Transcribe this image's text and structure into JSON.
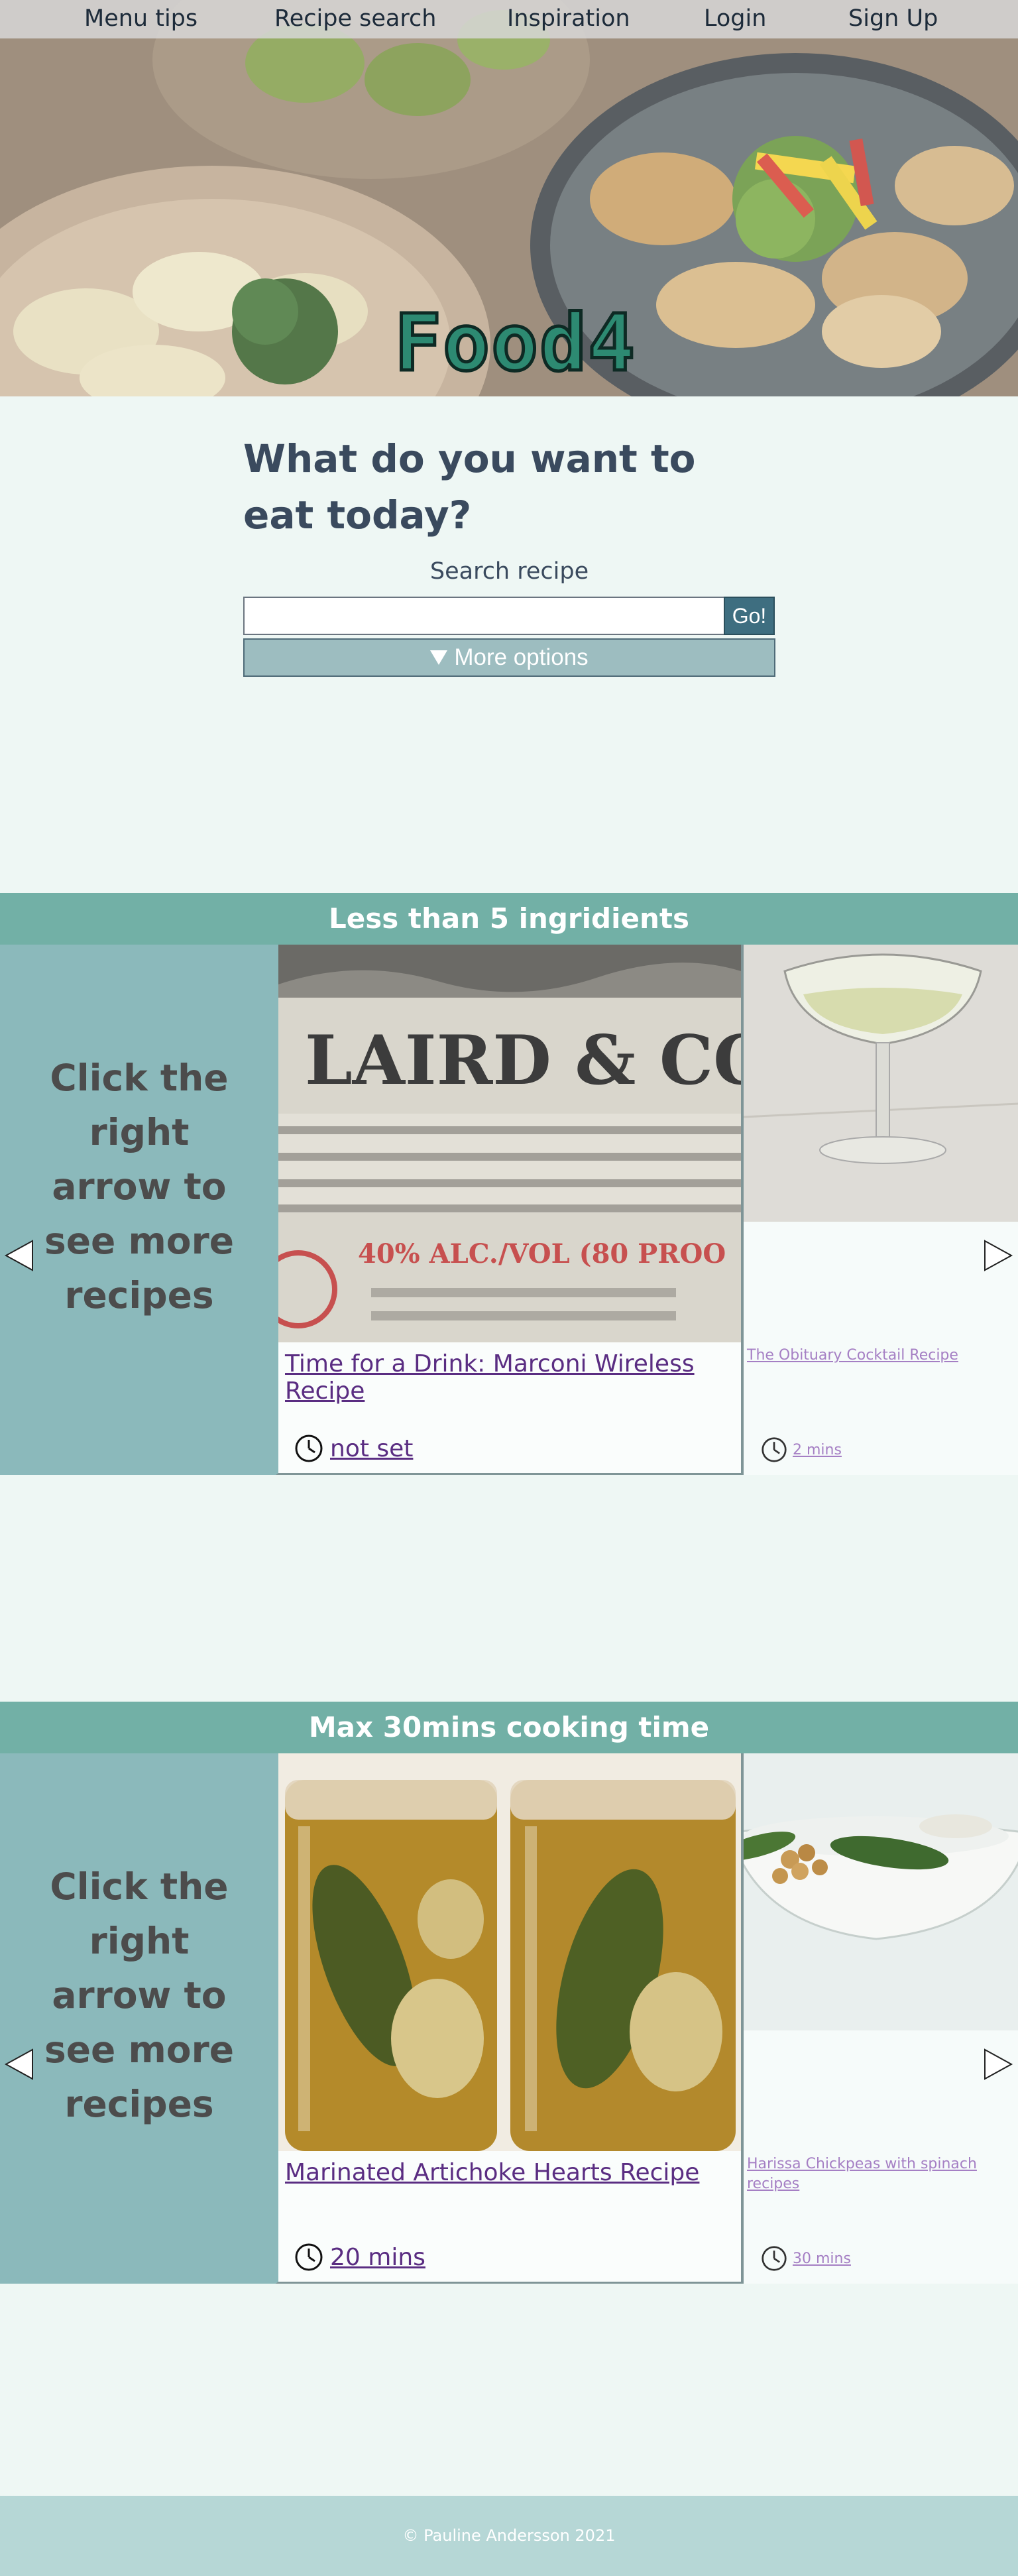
{
  "nav": {
    "items": [
      "Menu tips",
      "Recipe search",
      "Inspiration",
      "Login",
      "Sign Up"
    ]
  },
  "hero": {
    "logo": "Food4"
  },
  "search": {
    "heading": "What do you want to eat today?",
    "label": "Search recipe",
    "input_value": "",
    "go_label": "Go!",
    "more_options_label": "More options",
    "more_options_icon": "triangle-down-icon"
  },
  "sections": [
    {
      "title": "Less than 5 ingridients",
      "side_text": "Click the right arrow to see more recipes",
      "main_card": {
        "title": "Time for a Drink: Marconi Wireless Recipe",
        "time": "not set",
        "image_text_1": "LAIRD & COMPA",
        "image_text_2": "40% ALC./VOL (80 PROO"
      },
      "next_card": {
        "title": "The Obituary Cocktail Recipe",
        "time": "2 mins"
      }
    },
    {
      "title": "Max 30mins cooking time",
      "side_text": "Click the right arrow to see more recipes",
      "main_card": {
        "title": "Marinated Artichoke Hearts Recipe",
        "time": "20 mins"
      },
      "next_card": {
        "title": "Harissa Chickpeas with spinach recipes",
        "time": "30 mins"
      }
    }
  ],
  "footer": {
    "text": "© Pauline Andersson 2021"
  },
  "colors": {
    "section_header": "#72b0a6",
    "side_panel": "#8bb9bb",
    "page_bg": "#eef7f4",
    "link": "#5a2d82",
    "footer_bg": "#b6d7d6"
  }
}
